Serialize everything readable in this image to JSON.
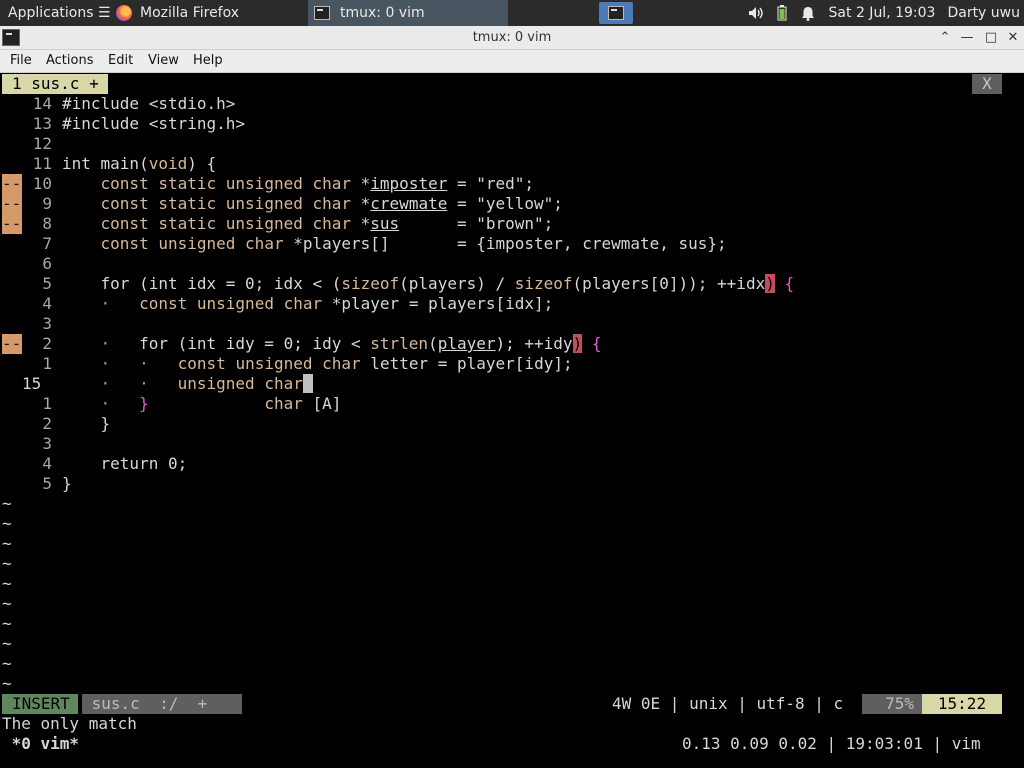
{
  "panel": {
    "apps_label": "Applications ☰",
    "firefox_task": "Mozilla Firefox",
    "tmux_task": "tmux: 0 vim",
    "datetime": "Sat  2 Jul, 19:03",
    "user": "Darty uwu"
  },
  "window": {
    "title": "tmux: 0 vim",
    "btn_up": "⌃",
    "btn_min": "—",
    "btn_max": "□",
    "btn_close": "✕"
  },
  "menubar": {
    "file": "File",
    "actions": "Actions",
    "edit": "Edit",
    "view": "View",
    "help": "Help"
  },
  "vim": {
    "tab_label": "1 sus.c +",
    "tab_close": "X",
    "code_lines": [
      {
        "num": "14",
        "sign": "",
        "text": "#include <stdio.h>"
      },
      {
        "num": "13",
        "sign": "",
        "text": "#include <string.h>"
      },
      {
        "num": "12",
        "sign": "",
        "text": ""
      },
      {
        "num": "11",
        "sign": "",
        "text": "int main(void) {"
      },
      {
        "num": "10",
        "sign": "--",
        "text": "    const static unsigned char *imposter = \"red\";"
      },
      {
        "num": "9",
        "sign": "--",
        "text": "    const static unsigned char *crewmate = \"yellow\";"
      },
      {
        "num": "8",
        "sign": "--",
        "text": "    const static unsigned char *sus      = \"brown\";"
      },
      {
        "num": "7",
        "sign": "",
        "text": "    const unsigned char *players[]       = {imposter, crewmate, sus};"
      },
      {
        "num": "6",
        "sign": "",
        "text": ""
      },
      {
        "num": "5",
        "sign": "",
        "text": "    for (int idx = 0; idx < (sizeof(players) / sizeof(players[0])); ++idx) {"
      },
      {
        "num": "4",
        "sign": "",
        "text": "    ·   const unsigned char *player = players[idx];"
      },
      {
        "num": "3",
        "sign": "",
        "text": ""
      },
      {
        "num": "2",
        "sign": "--",
        "text": "    ·   for (int idy = 0; idy < strlen(player); ++idy) {"
      },
      {
        "num": "1",
        "sign": "",
        "text": "    ·   ·   const unsigned char letter = player[idy];"
      },
      {
        "num": "15",
        "sign": "",
        "text": "    ·   ·   unsigned char"
      },
      {
        "num": "1",
        "sign": "",
        "text": "    ·   }            char [A]"
      },
      {
        "num": "2",
        "sign": "",
        "text": "    }"
      },
      {
        "num": "3",
        "sign": "",
        "text": ""
      },
      {
        "num": "4",
        "sign": "",
        "text": "    return 0;"
      },
      {
        "num": "5",
        "sign": "",
        "text": "}"
      }
    ],
    "tilde": "~",
    "status": {
      "mode": "INSERT",
      "file_segment": " sus.c  :/  + ",
      "right_info": "4W 0E | unix | utf-8 | c",
      "percent": " 75%",
      "position": "15:22"
    },
    "message": "The only match"
  },
  "tmux": {
    "window_list": " *0 vim*",
    "right": "0.13 0.09 0.02 | 19:03:01 | vim"
  },
  "colors": {
    "panel_bg": "#2b2b2b",
    "active_task_bg": "#4a5562",
    "workspace_bg": "#4d7bb8",
    "sign_bg": "#d49a6a",
    "insert_bg": "#5f875f",
    "tab_bg": "#d7d7a7",
    "paren_match": "#c44d5b"
  }
}
